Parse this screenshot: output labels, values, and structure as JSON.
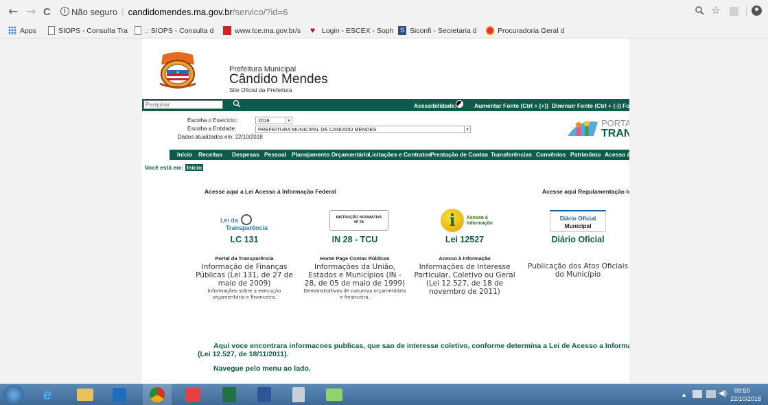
{
  "browser": {
    "back_icon": "←",
    "forward_icon": "→",
    "reload_icon": "C",
    "security_label": "Não seguro",
    "url_domain": "candidomendes.ma.gov.br",
    "url_path": "/servico/?id=6",
    "bookmarks": [
      {
        "label": "Apps",
        "icon": "apps-icon"
      },
      {
        "label": "SIOPS - Consulta Tra",
        "icon": "page-icon"
      },
      {
        "label": ".: SIOPS - Consulta d",
        "icon": "page-icon"
      },
      {
        "label": "www.tce.ma.gov.br/s",
        "icon": "tce-icon"
      },
      {
        "label": "Login - ESCEX - Soph",
        "icon": "heart-icon"
      },
      {
        "label": "Siconfi - Secretaria d",
        "icon": "siconfi-icon"
      },
      {
        "label": "Procuradoria Geral d",
        "icon": "procuradoria-icon"
      }
    ]
  },
  "site": {
    "pref_label": "Prefeitura Municipal",
    "city": "Cândido Mendes",
    "subtitle": "Site Oficial da Prefeitura",
    "search_placeholder": "Pesquisar",
    "accessibility": "Acessibilidade:",
    "font_up": "Aumentar Fonte (Ctrl + (+))",
    "font_down": "Diminuir Fonte (Ctrl + (-))",
    "font_more": "Fo",
    "exercicio_label": "Escolha o Exercício:",
    "exercicio_value": "2018",
    "entidade_label": "Escolha a Entidade:",
    "entidade_value": "PREFEITURA MUNICIPAL DE CANDIDO MENDES",
    "dados_label": "Dados atualizados em: 22/10/2018",
    "portal_line1": "PORTA",
    "portal_line2": "TRAN",
    "menu": [
      "Início",
      "Receitas",
      "Despesas",
      "Pessoal",
      "Planejamento Orçamentário",
      "Licitações e Contratos",
      "Prestação de Contas",
      "Transferências",
      "Convênios",
      "Patrimônio",
      "Acesso à"
    ],
    "breadcrumb_label": "Você está em:",
    "breadcrumb_current": "Início",
    "acesse_federal": "Acesse aqui a Lei Acesso à Informação Federal",
    "acesse_local": "Acesse aqui Regulamentação loca",
    "cards": [
      {
        "logo1": "Lei da",
        "logo2": "Transparência",
        "title": "LC 131",
        "sub": "Portal da Transparência",
        "desc": "Informação de Finanças Públicas (Lei 131, de 27 de maio de 2009)",
        "note": "Informações sobre a execução orçamentária e financeira."
      },
      {
        "logo1": "INSTRUÇÃO NORMATIVA",
        "logo2": "Nº 28",
        "title": "IN 28 - TCU",
        "sub": "Home Page Contas Públicas",
        "desc": "Informações da União, Estados e Municípios (IN - 28, de 05 de maio de 1999)",
        "note": "Demonstrativos de natureza orçamentária e financeira."
      },
      {
        "logo1": "Acesso à",
        "logo2": "Informação",
        "title": "Lei 12527",
        "sub": "Acesso à Informação",
        "desc": "Informações de Interesse Particular, Coletivo ou Geral (Lei 12.527, de 18 de novembro de 2011)",
        "note": ""
      },
      {
        "logo1": "Diário Oficial",
        "logo2": "Municipal",
        "title": "Diário Oficial",
        "sub": "",
        "desc": "Publicação dos Atos Oficiais do Município",
        "note": ""
      }
    ],
    "info_line1": "Aqui voce encontrara informacoes publicas, que sao de interesse coletivo, conforme determina a Lei de Acesso a Informacao",
    "info_line2": "(Lei 12.527, de 18/11/2011).",
    "navegue": "Navegue pelo menu ao lado."
  },
  "taskbar": {
    "time": "09:59",
    "date": "22/10/2018"
  },
  "colors": {
    "site_green": "#0b5c4a",
    "title_green": "#0b5c4a",
    "taskbar": "#4a78a5"
  }
}
